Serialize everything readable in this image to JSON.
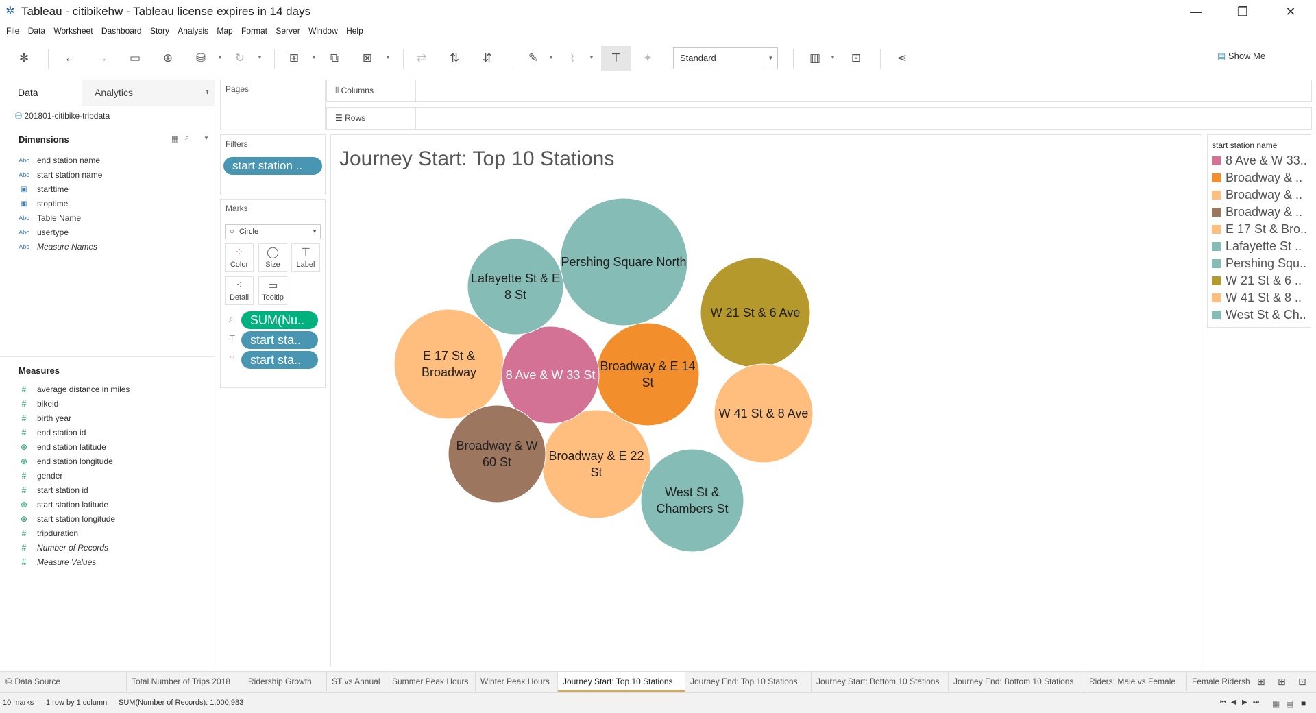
{
  "window": {
    "title": "Tableau - citibikehw - Tableau license expires in 14 days",
    "controls": [
      "minimize-icon",
      "restore-icon",
      "close-icon"
    ]
  },
  "menu": [
    "File",
    "Data",
    "Worksheet",
    "Dashboard",
    "Story",
    "Analysis",
    "Map",
    "Format",
    "Server",
    "Window",
    "Help"
  ],
  "toolbar": {
    "fit_select": "Standard",
    "show_me": "Show Me"
  },
  "datapane": {
    "tab_data": "Data",
    "tab_analytics": "Analytics",
    "datasource": "201801-citibike-tripdata",
    "dimensions_title": "Dimensions",
    "dimensions": [
      {
        "icon": "Abc",
        "name": "end station name",
        "italic": false
      },
      {
        "icon": "Abc",
        "name": "start station name",
        "italic": false
      },
      {
        "icon": "date",
        "name": "starttime",
        "italic": false
      },
      {
        "icon": "date",
        "name": "stoptime",
        "italic": false
      },
      {
        "icon": "Abc",
        "name": "Table Name",
        "italic": false
      },
      {
        "icon": "Abc",
        "name": "usertype",
        "italic": false
      },
      {
        "icon": "Abc",
        "name": "Measure Names",
        "italic": true
      }
    ],
    "measures_title": "Measures",
    "measures": [
      {
        "icon": "#",
        "name": "average distance in miles",
        "italic": false
      },
      {
        "icon": "#",
        "name": "bikeid",
        "italic": false
      },
      {
        "icon": "#",
        "name": "birth year",
        "italic": false
      },
      {
        "icon": "#",
        "name": "end station id",
        "italic": false
      },
      {
        "icon": "globe",
        "name": "end station latitude",
        "italic": false
      },
      {
        "icon": "globe",
        "name": "end station longitude",
        "italic": false
      },
      {
        "icon": "#",
        "name": "gender",
        "italic": false
      },
      {
        "icon": "#",
        "name": "start station id",
        "italic": false
      },
      {
        "icon": "globe",
        "name": "start station latitude",
        "italic": false
      },
      {
        "icon": "globe",
        "name": "start station longitude",
        "italic": false
      },
      {
        "icon": "#",
        "name": "tripduration",
        "italic": false
      },
      {
        "icon": "#",
        "name": "Number of Records",
        "italic": true
      },
      {
        "icon": "#",
        "name": "Measure Values",
        "italic": true
      }
    ]
  },
  "shelves": {
    "pages": "Pages",
    "filters": "Filters",
    "filter_pill": "start station ..",
    "marks": "Marks",
    "mark_type": "Circle",
    "mark_buttons": [
      "Color",
      "Size",
      "Label",
      "Detail",
      "Tooltip"
    ],
    "mark_pills": [
      "SUM(Nu..",
      "start sta..",
      "start sta.."
    ],
    "columns": "Columns",
    "rows": "Rows"
  },
  "viz": {
    "title": "Journey Start: Top 10 Stations"
  },
  "legend": {
    "title": "start station name",
    "items": [
      {
        "label": "8 Ave & W 33..",
        "color": "#d37295"
      },
      {
        "label": "Broadway & ..",
        "color": "#f28e2b"
      },
      {
        "label": "Broadway & ..",
        "color": "#ffbe7d"
      },
      {
        "label": "Broadway & ..",
        "color": "#9d7660"
      },
      {
        "label": "E 17 St & Bro..",
        "color": "#ffbe7d"
      },
      {
        "label": "Lafayette St ..",
        "color": "#86bcb6"
      },
      {
        "label": "Pershing Squ..",
        "color": "#86bcb6"
      },
      {
        "label": "W 21 St & 6 ..",
        "color": "#b6992d"
      },
      {
        "label": "W 41 St & 8 ..",
        "color": "#ffbe7d"
      },
      {
        "label": "West St & Ch..",
        "color": "#86bcb6"
      }
    ]
  },
  "chart_data": {
    "type": "bubble",
    "title": "Journey Start: Top 10 Stations",
    "size_measure": "SUM(Number of Records)",
    "labels_printed": true,
    "bubbles": [
      {
        "label": "Pershing Square North",
        "color": "#86bcb6",
        "size_rank": 1
      },
      {
        "label": "W 21 St & 6 Ave",
        "color": "#b6992d",
        "size_rank": 2
      },
      {
        "label": "E 17 St & Broadway",
        "color": "#ffbe7d",
        "size_rank": 3
      },
      {
        "label": "Broadway & E 22 St",
        "color": "#ffbe7d",
        "size_rank": 4
      },
      {
        "label": "Broadway & E 14 St",
        "color": "#f28e2b",
        "size_rank": 5
      },
      {
        "label": "West St & Chambers St",
        "color": "#86bcb6",
        "size_rank": 6
      },
      {
        "label": "W 41 St & 8 Ave",
        "color": "#ffbe7d",
        "size_rank": 7
      },
      {
        "label": "8 Ave & W 33 St",
        "color": "#d37295",
        "size_rank": 8
      },
      {
        "label": "Lafayette St & E 8 St",
        "color": "#86bcb6",
        "size_rank": 9
      },
      {
        "label": "Broadway & W 60 St",
        "color": "#9d7660",
        "size_rank": 10
      }
    ]
  },
  "sheet_tabs": [
    {
      "label": "Data Source",
      "active": false
    },
    {
      "label": "Total Number of Trips 2018",
      "active": false
    },
    {
      "label": "Ridership Growth",
      "active": false
    },
    {
      "label": "ST vs Annual",
      "active": false
    },
    {
      "label": "Summer Peak Hours",
      "active": false
    },
    {
      "label": "Winter Peak Hours",
      "active": false
    },
    {
      "label": "Journey Start: Top 10 Stations",
      "active": true
    },
    {
      "label": "Journey End: Top 10 Stations",
      "active": false
    },
    {
      "label": "Journey Start: Bottom 10 Stations",
      "active": false
    },
    {
      "label": "Journey End: Bottom 10 Stations",
      "active": false
    },
    {
      "label": "Riders: Male vs Female",
      "active": false
    },
    {
      "label": "Female Ridershi",
      "active": false
    }
  ],
  "status": {
    "marks": "10 marks",
    "dims": "1 row by 1 column",
    "sum": "SUM(Number of Records): 1,000,983"
  }
}
